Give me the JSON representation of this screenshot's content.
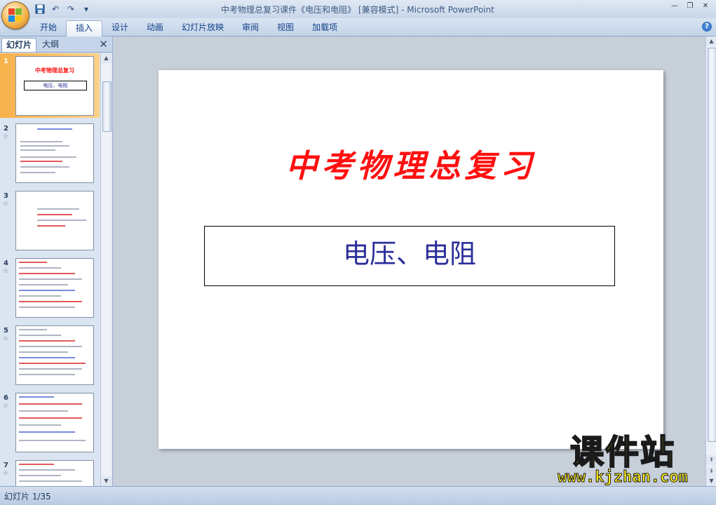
{
  "window": {
    "title": "中考物理总复习课件《电压和电阻》 [兼容模式] - Microsoft PowerPoint",
    "controls": [
      "minimize",
      "restore",
      "close"
    ]
  },
  "quick_access": [
    "save-icon",
    "undo-icon",
    "redo-icon",
    "customize-icon"
  ],
  "ribbon": {
    "tabs": [
      {
        "label": "开始",
        "active": false
      },
      {
        "label": "插入",
        "active": true
      },
      {
        "label": "设计",
        "active": false
      },
      {
        "label": "动画",
        "active": false
      },
      {
        "label": "幻灯片放映",
        "active": false
      },
      {
        "label": "审阅",
        "active": false
      },
      {
        "label": "视图",
        "active": false
      },
      {
        "label": "加载项",
        "active": false
      }
    ],
    "help": "?"
  },
  "left_pane": {
    "tabs": [
      "幻灯片",
      "大纲"
    ],
    "close": "✕",
    "slides": [
      {
        "number": "1",
        "selected": true
      },
      {
        "number": "2",
        "selected": false,
        "animated": true
      },
      {
        "number": "3",
        "selected": false,
        "animated": true
      },
      {
        "number": "4",
        "selected": false,
        "animated": true
      },
      {
        "number": "5",
        "selected": false,
        "animated": true
      },
      {
        "number": "6",
        "selected": false,
        "animated": true
      },
      {
        "number": "7",
        "selected": false,
        "animated": true
      }
    ],
    "thumb1": {
      "title": "中考物理总复习",
      "subtitle": "电压、电阻"
    }
  },
  "slide": {
    "title": "中考物理总复习",
    "subtitle": "电压、电阻"
  },
  "status": {
    "slide_count": "幻灯片 1/35"
  },
  "watermark": {
    "main": "课件站",
    "url": "www.kjzhan.com"
  },
  "colors": {
    "accent": "#f7b149",
    "title_red": "#ff1010",
    "subtitle_blue": "#2b2f9a",
    "watermark_yellow": "#ffee1a"
  }
}
